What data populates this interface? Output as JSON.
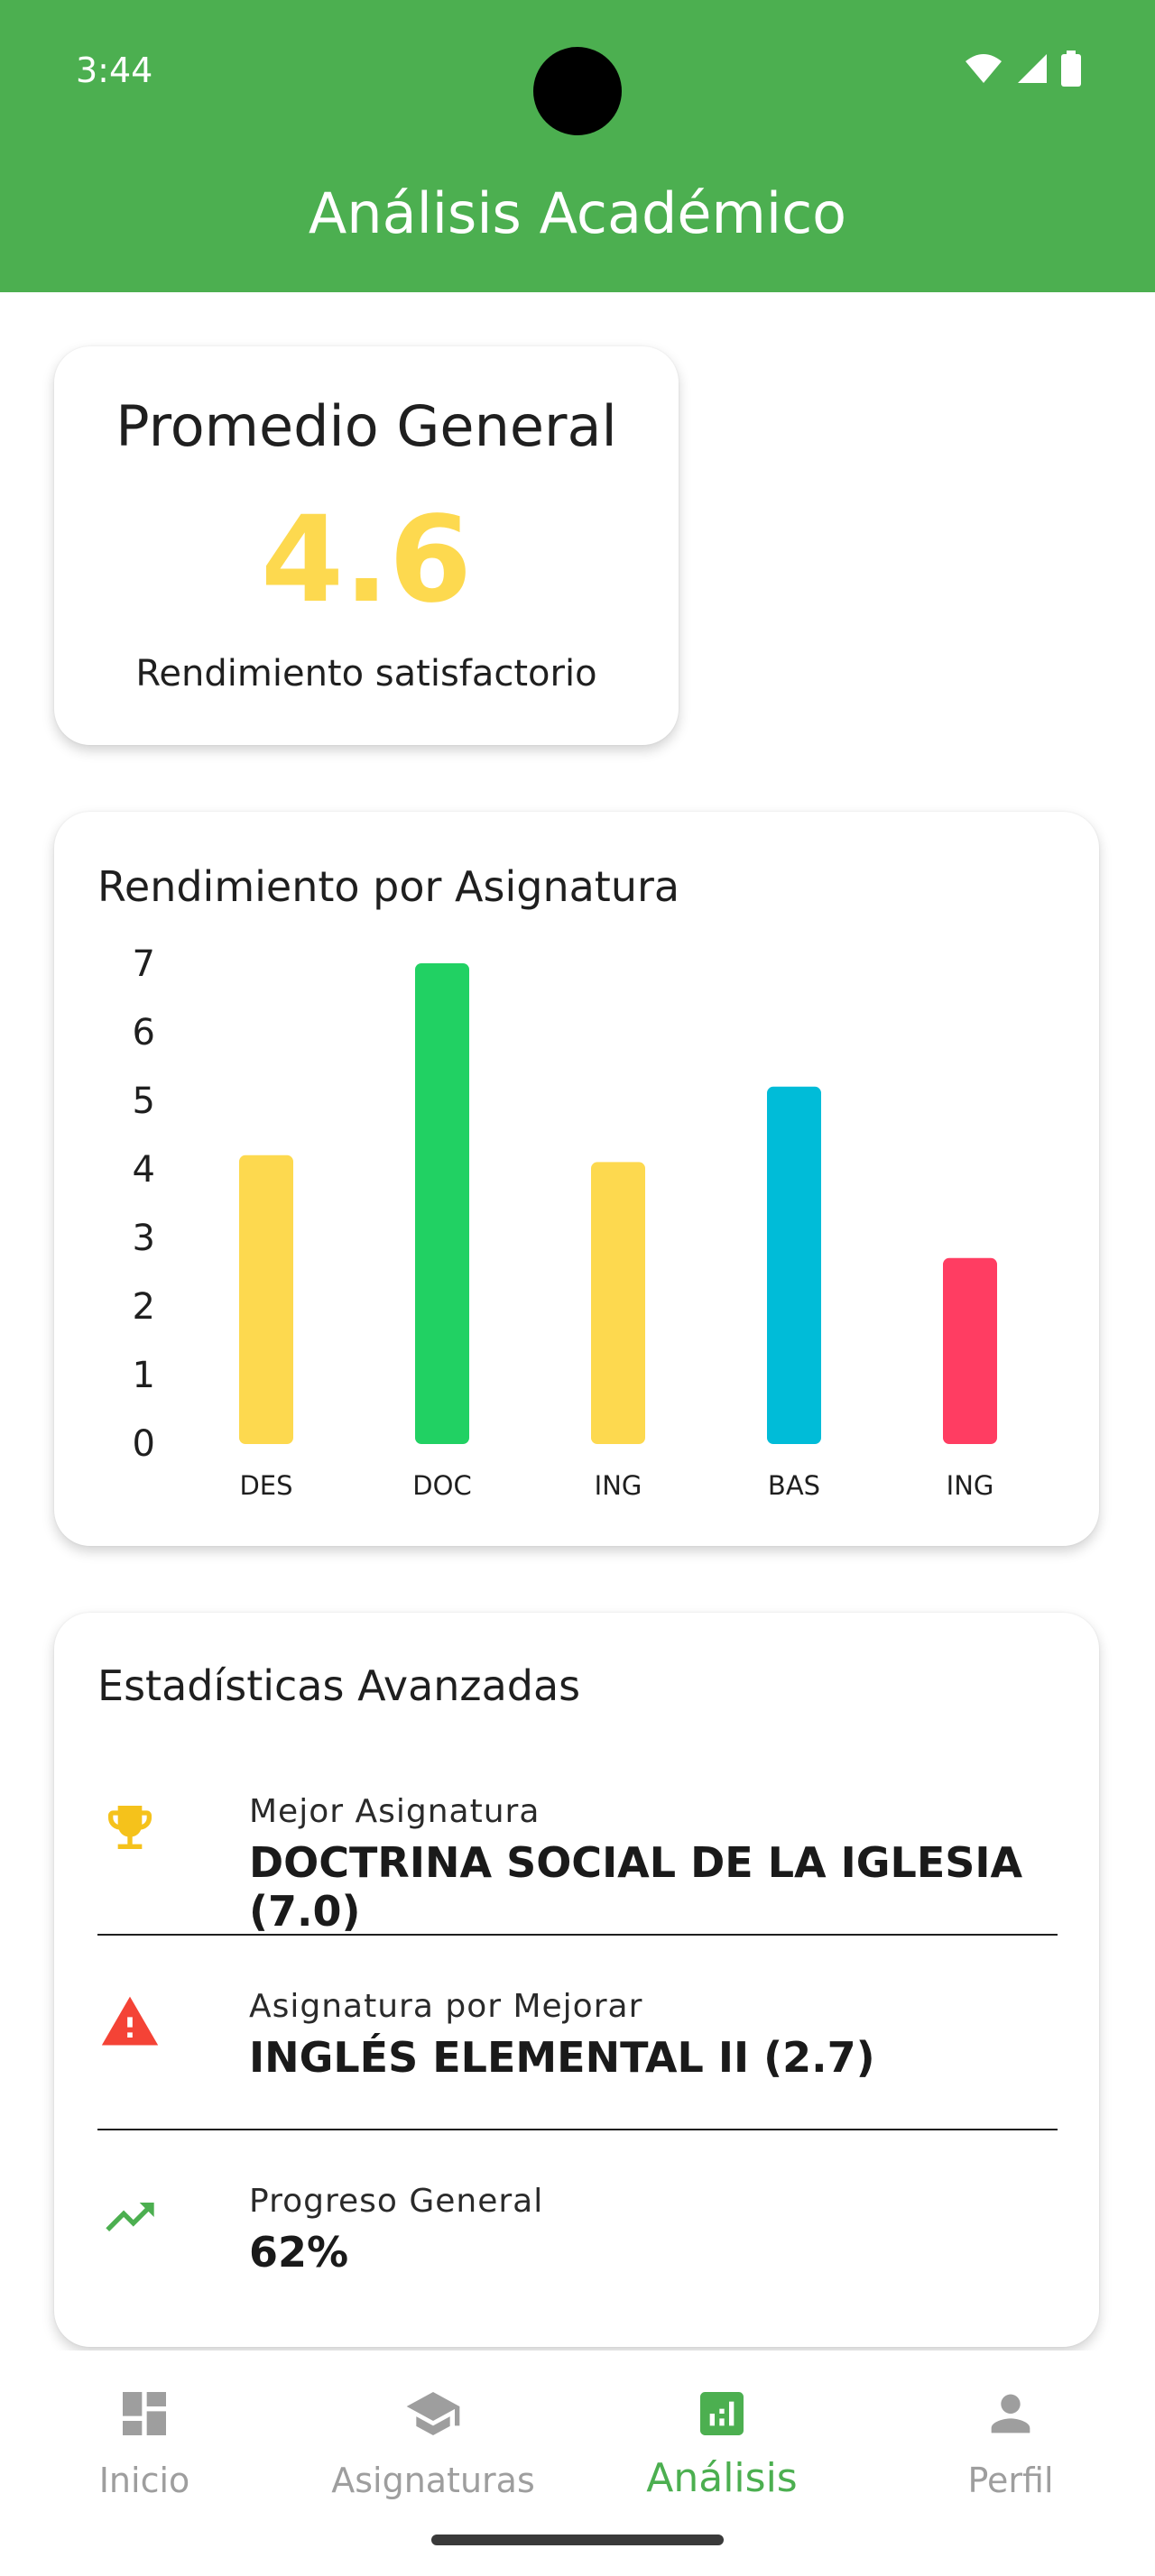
{
  "status_bar": {
    "time": "3:44"
  },
  "app_bar": {
    "title": "Análisis Académico"
  },
  "average_card": {
    "title": "Promedio General",
    "value": "4.6",
    "description": "Rendimiento satisfactorio"
  },
  "chart_card": {
    "title": "Rendimiento por Asignatura"
  },
  "chart_data": {
    "type": "bar",
    "title": "Rendimiento por Asignatura",
    "categories": [
      "DES",
      "DOC",
      "ING",
      "BAS",
      "ING"
    ],
    "values": [
      4.2,
      7.0,
      4.1,
      5.2,
      2.7
    ],
    "colors": [
      "#fdd94f",
      "#21d163",
      "#fdd94f",
      "#00bcd8",
      "#ff3d62"
    ],
    "ylim": [
      0,
      7
    ],
    "yticks": [
      "0",
      "1",
      "2",
      "3",
      "4",
      "5",
      "6",
      "7"
    ],
    "grid": false,
    "legend": "none"
  },
  "stats": {
    "title": "Estadísticas Avanzadas",
    "items": [
      {
        "label": "Mejor Asignatura",
        "value": "DOCTRINA SOCIAL DE LA IGLESIA (7.0)",
        "icon": "trophy-icon",
        "color": "#f5c21b"
      },
      {
        "label": "Asignatura por Mejorar",
        "value": "INGLÉS ELEMENTAL II (2.7)",
        "icon": "warning-icon",
        "color": "#f44336"
      },
      {
        "label": "Progreso General",
        "value": "62%",
        "icon": "trending-up-icon",
        "color": "#4caf50"
      }
    ]
  },
  "bottom_nav": {
    "items": [
      {
        "label": "Inicio",
        "icon": "dashboard-icon",
        "active": false
      },
      {
        "label": "Asignaturas",
        "icon": "school-icon",
        "active": false
      },
      {
        "label": "Análisis",
        "icon": "analytics-icon",
        "active": true
      },
      {
        "label": "Perfil",
        "icon": "person-icon",
        "active": false
      }
    ]
  }
}
